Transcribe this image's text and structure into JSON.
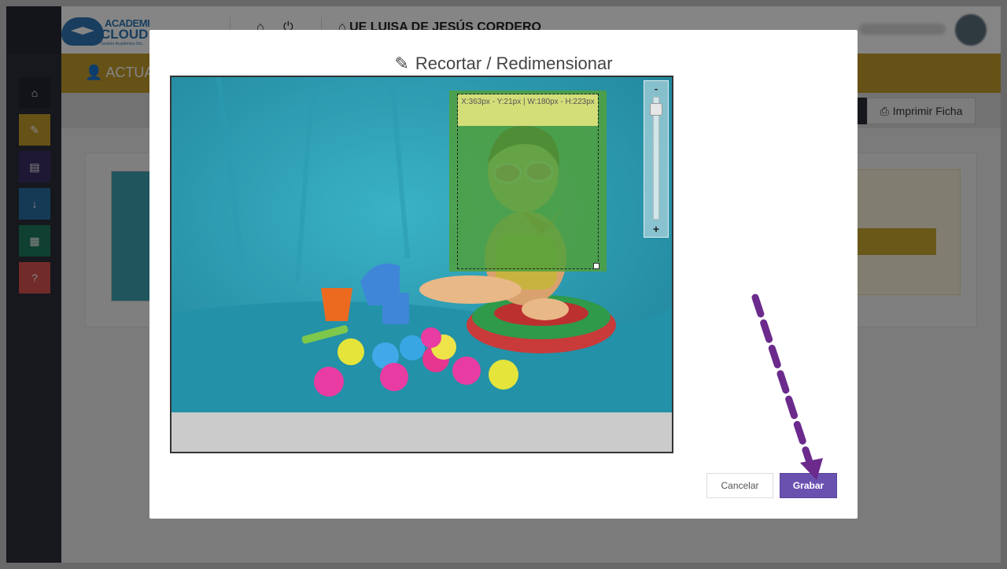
{
  "app": {
    "logo_line1": "ACADEMI",
    "logo_line2": "CLOUD",
    "logo_tagline": "Gestión Académica Onl...",
    "school_name": "UE LUISA DE JESÚS CORDERO",
    "page_title": "ACTUAL"
  },
  "sidebar": {
    "items": [
      {
        "icon": "home-icon",
        "color": "#22262e"
      },
      {
        "icon": "edit-icon",
        "color": "#c49b2c"
      },
      {
        "icon": "clipboard-icon",
        "color": "#3d2f66"
      },
      {
        "icon": "sort-numeric-icon",
        "color": "#2a6fa6"
      },
      {
        "icon": "calendar-icon",
        "color": "#1e7c5e"
      },
      {
        "icon": "help-icon",
        "color": "#d9534f"
      }
    ]
  },
  "toolbar": {
    "print_label": "Imprimir Ficha"
  },
  "modal": {
    "title": "Recortar / Redimensionar",
    "crop_info": "X:363px - Y:21px | W:180px - H:223px",
    "zoom_minus": "-",
    "zoom_plus": "+",
    "cancel_label": "Cancelar",
    "save_label": "Grabar"
  },
  "colors": {
    "accent_gold": "#c49b2c",
    "save_button": "#6a51b0",
    "annotation_arrow": "#6b2a8c"
  }
}
